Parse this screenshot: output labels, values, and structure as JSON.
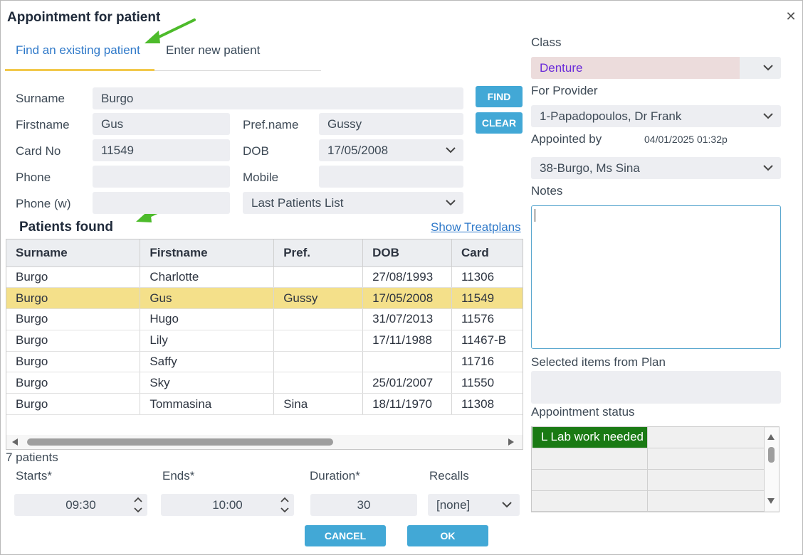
{
  "dialog": {
    "title": "Appointment for patient"
  },
  "tabs": {
    "find_existing": "Find an existing patient",
    "enter_new": "Enter new patient"
  },
  "search": {
    "surname_label": "Surname",
    "surname_value": "Burgo",
    "firstname_label": "Firstname",
    "firstname_value": "Gus",
    "prefname_label": "Pref.name",
    "prefname_value": "Gussy",
    "cardno_label": "Card No",
    "cardno_value": "11549",
    "dob_label": "DOB",
    "dob_value": "17/05/2008",
    "phone_label": "Phone",
    "phone_value": "",
    "mobile_label": "Mobile",
    "mobile_value": "",
    "phonew_label": "Phone (w)",
    "phonew_value": "",
    "list_select": "Last Patients List",
    "find_button": "FIND",
    "clear_button": "CLEAR"
  },
  "patients": {
    "title": "Patients found",
    "show_treatplans": "Show Treatplans",
    "columns": [
      "Surname",
      "Firstname",
      "Pref.",
      "DOB",
      "Card"
    ],
    "rows": [
      [
        "Burgo",
        "Charlotte",
        "",
        "27/08/1993",
        "11306"
      ],
      [
        "Burgo",
        "Gus",
        "Gussy",
        "17/05/2008",
        "11549"
      ],
      [
        "Burgo",
        "Hugo",
        "",
        "31/07/2013",
        "11576"
      ],
      [
        "Burgo",
        "Lily",
        "",
        "17/11/1988",
        "11467-B"
      ],
      [
        "Burgo",
        "Saffy",
        "",
        "",
        "11716"
      ],
      [
        "Burgo",
        "Sky",
        "",
        "25/01/2007",
        "11550"
      ],
      [
        "Burgo",
        "Tommasina",
        "Sina",
        "18/11/1970",
        "11308"
      ]
    ],
    "selected_row": 1,
    "count_text": "7 patients"
  },
  "time": {
    "starts_label": "Starts*",
    "starts_value": "09:30",
    "ends_label": "Ends*",
    "ends_value": "10:00",
    "duration_label": "Duration*",
    "duration_value": "30",
    "recalls_label": "Recalls",
    "recalls_value": "[none]"
  },
  "actions": {
    "cancel": "CANCEL",
    "ok": "OK"
  },
  "right": {
    "class_label": "Class",
    "class_value": "Denture",
    "provider_label": "For Provider",
    "provider_value": "1-Papadopoulos, Dr Frank",
    "appointed_by_label": "Appointed by",
    "appointed_timestamp": "04/01/2025 01:32p",
    "appointed_by_value": "38-Burgo, Ms Sina",
    "notes_label": "Notes",
    "notes_value": "",
    "selected_items_label": "Selected items from Plan",
    "status_label": "Appointment status",
    "status_first": "L Lab work needed"
  },
  "colors": {
    "accent": "#42a8d6",
    "link": "#2f79c9",
    "selected_row": "#f4e08a",
    "status_green": "#1a7a14",
    "class_bg": "#ecdcdc",
    "class_text": "#6a2bd9"
  }
}
